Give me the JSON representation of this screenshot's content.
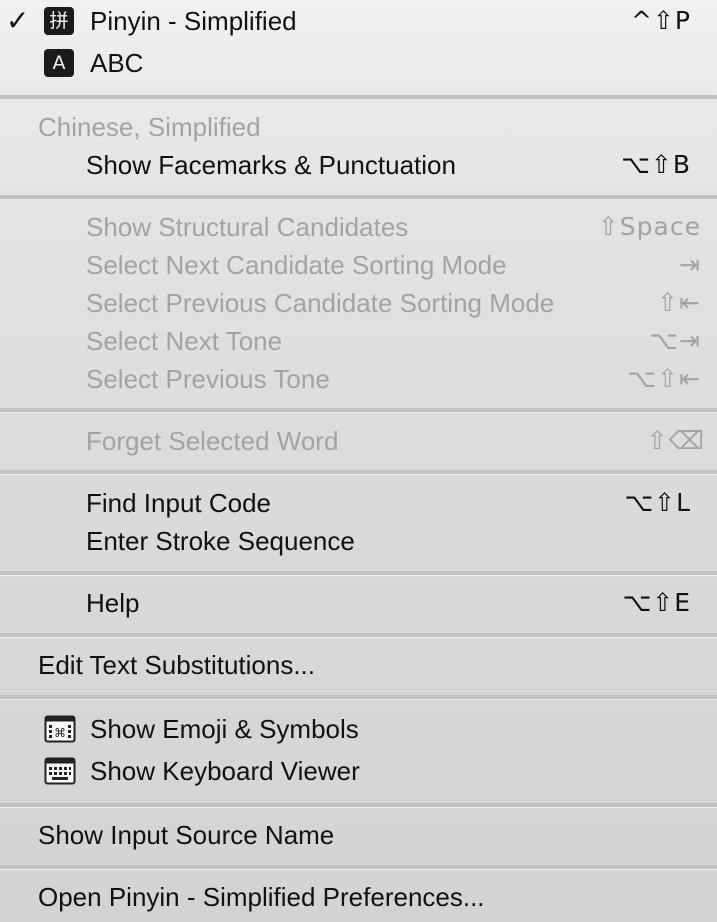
{
  "input_sources": [
    {
      "label": "Pinyin - Simplified",
      "badge": "拼",
      "checked": "✓",
      "shortcut": "^⇧P"
    },
    {
      "label": "ABC",
      "badge": "A"
    }
  ],
  "pinyin_section": {
    "heading": "Chinese, Simplified",
    "facemarks": {
      "label": "Show Facemarks & Punctuation",
      "shortcut": "⌥⇧B"
    }
  },
  "candidate_section": [
    {
      "label": "Show Structural Candidates",
      "shortcut": "⇧Space"
    },
    {
      "label": "Select Next Candidate Sorting Mode",
      "shortcut": "⇥"
    },
    {
      "label": "Select Previous Candidate Sorting Mode",
      "shortcut": "⇧⇤"
    },
    {
      "label": "Select Next Tone",
      "shortcut": "⌥⇥"
    },
    {
      "label": "Select Previous Tone",
      "shortcut": "⌥⇧⇤"
    }
  ],
  "forget_word": {
    "label": "Forget Selected Word",
    "shortcut": "⇧⌫"
  },
  "input_code": [
    {
      "label": "Find Input Code",
      "shortcut": "⌥⇧L"
    },
    {
      "label": "Enter Stroke Sequence"
    }
  ],
  "help": {
    "label": "Help",
    "shortcut": "⌥⇧E"
  },
  "edit_substitutions": {
    "label": "Edit Text Substitutions..."
  },
  "viewers": [
    {
      "label": "Show Emoji & Symbols",
      "icon": "emoji-symbols-icon"
    },
    {
      "label": "Show Keyboard Viewer",
      "icon": "keyboard-viewer-icon"
    }
  ],
  "show_source_name": {
    "label": "Show Input Source Name"
  },
  "preferences": {
    "label": "Open Pinyin - Simplified Preferences..."
  },
  "colors": {
    "enabled_text": "#111111",
    "disabled_text": "#a3a3a3",
    "separator": "#c2c2c2"
  }
}
